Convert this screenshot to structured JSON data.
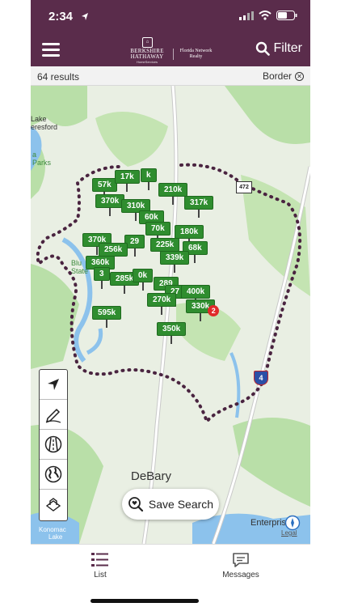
{
  "status": {
    "time": "2:34"
  },
  "navbar": {
    "brand_left": "BERKSHIRE HATHAWAY",
    "brand_sub": "HomeServices",
    "brand_right": "Florida Network Realty",
    "filter_label": "Filter"
  },
  "subbar": {
    "results": "64 results",
    "border_label": "Border"
  },
  "map": {
    "places": [
      {
        "key": "lake_helen_tail",
        "text": "Lake"
      },
      {
        "key": "beresford",
        "text": "eresford"
      },
      {
        "key": "parks_a",
        "text": "a"
      },
      {
        "key": "parks",
        "text": "Parks"
      },
      {
        "key": "blue_spring",
        "text": "Blu"
      },
      {
        "key": "state",
        "text": "State"
      },
      {
        "key": "debary",
        "text": "DeBary"
      },
      {
        "key": "enterprise",
        "text": "Enterprise"
      },
      {
        "key": "konomac",
        "text": "Konomac"
      },
      {
        "key": "lake",
        "text": "Lake"
      },
      {
        "key": "legal",
        "text": "Legal"
      }
    ],
    "shields": {
      "sr472": "472",
      "i4": "4"
    },
    "pins": [
      {
        "label": "57k"
      },
      {
        "label": "17k"
      },
      {
        "label": "k"
      },
      {
        "label": "210k"
      },
      {
        "label": "370k"
      },
      {
        "label": "310k"
      },
      {
        "label": "317k"
      },
      {
        "label": "60k"
      },
      {
        "label": "70k"
      },
      {
        "label": "180k"
      },
      {
        "label": "370k"
      },
      {
        "label": "29"
      },
      {
        "label": "256k"
      },
      {
        "label": "225k"
      },
      {
        "label": "68k"
      },
      {
        "label": "360k"
      },
      {
        "label": "339k"
      },
      {
        "label": "3"
      },
      {
        "label": "285k"
      },
      {
        "label": "0k"
      },
      {
        "label": "289"
      },
      {
        "label": "27"
      },
      {
        "label": "400k"
      },
      {
        "label": "270k"
      },
      {
        "label": "595k"
      },
      {
        "label": "330k"
      },
      {
        "label": "350k"
      }
    ],
    "cluster_count": "2",
    "tools": [
      "location-arrow-icon",
      "draw-pencil-icon",
      "road-icon",
      "globe-icon",
      "3d-house-icon"
    ],
    "save_search_label": "Save Search"
  },
  "tabbar": {
    "list_label": "List",
    "messages_label": "Messages"
  },
  "colors": {
    "brand": "#5a2c4b",
    "pin": "#2f8d2f",
    "badge": "#e02a2a",
    "boundary": "#4a2440"
  }
}
